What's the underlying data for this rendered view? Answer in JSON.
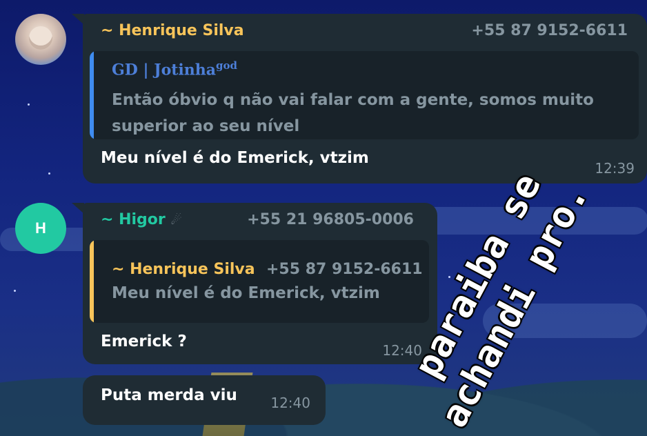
{
  "chat": {
    "messages": [
      {
        "sender": "~ Henrique Silva",
        "phone": "+55 87 9152-6611",
        "sender_color": "#f7c45a",
        "quote": {
          "author": "GD | Jotinha",
          "author_suffix": "god",
          "author_color": "#4d7fd8",
          "bar_color": "#3f8cf0",
          "text_line1": "Então óbvio q não vai falar com a gente, somos muito",
          "text_line2": "superior ao seu nível"
        },
        "text": "Meu nível é do Emerick, vtzim",
        "time": "12:39"
      },
      {
        "avatar_letter": "H",
        "sender": "~ Higor",
        "sender_emoji": "☄",
        "phone": "+55 21 96805-0006",
        "sender_color": "#22c9a2",
        "quote": {
          "author": "~ Henrique Silva",
          "phone": "+55 87 9152-6611",
          "author_color": "#f7c45a",
          "bar_color": "#f7c45a",
          "text": "Meu nível é do Emerick, vtzim"
        },
        "text": "Emerick ?",
        "time": "12:40"
      },
      {
        "text": "Puta merda viu",
        "time": "12:40"
      }
    ]
  },
  "overlay": {
    "line1": "paraiba se",
    "line2": "achandi pro."
  }
}
